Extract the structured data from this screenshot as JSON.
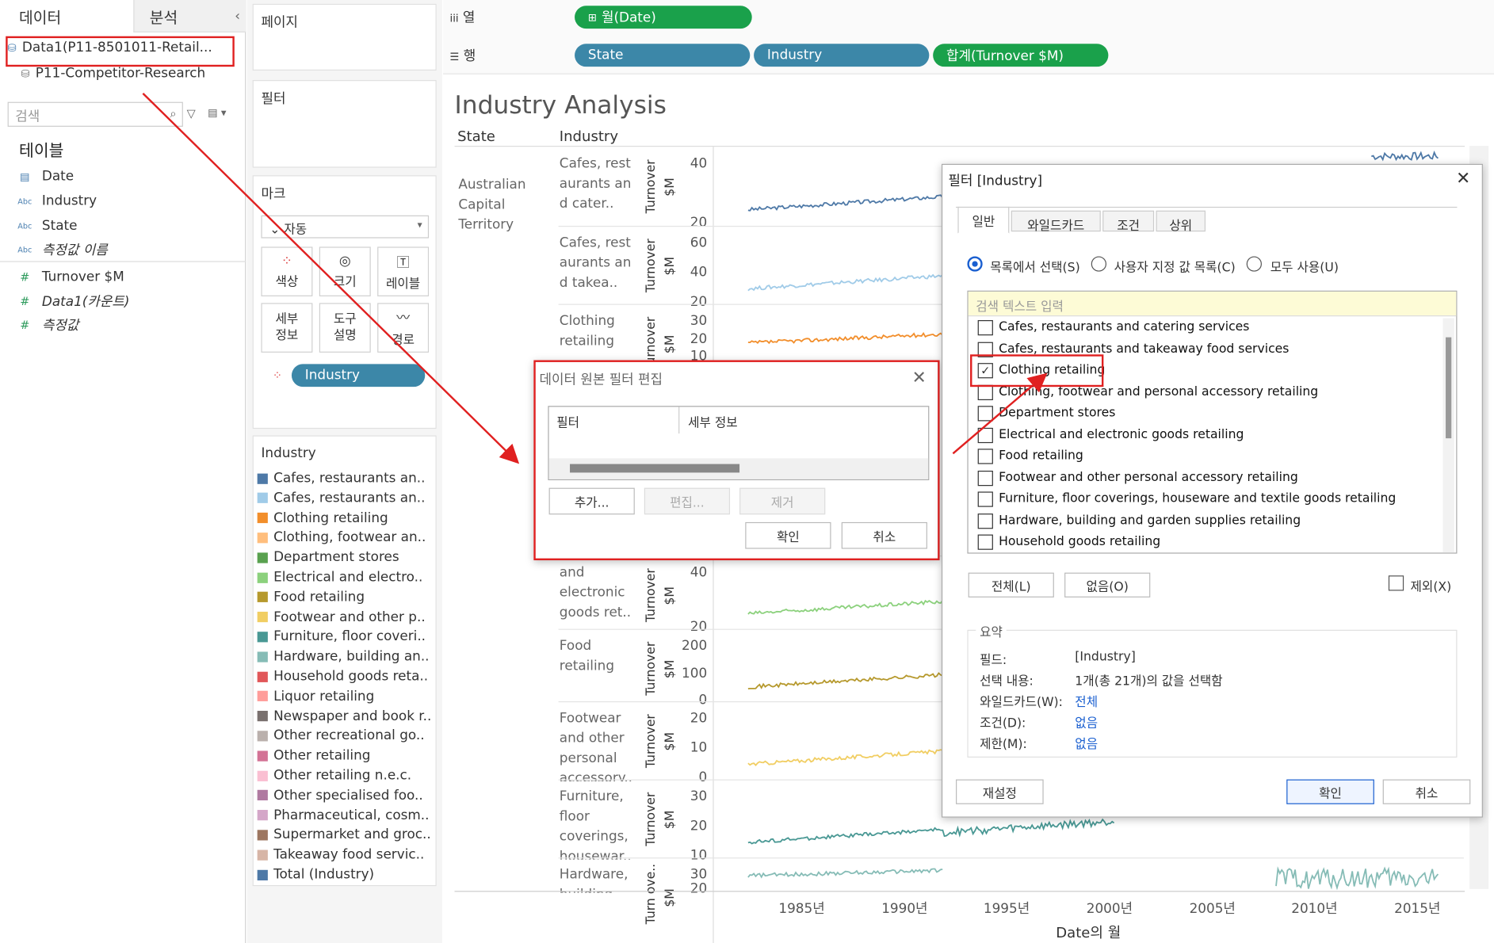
{
  "left": {
    "tab_data": "데이터",
    "tab_analysis": "분석",
    "collapse": "‹",
    "datasource_active": "Data1(P11-8501011-Retail...",
    "datasource_other": "P11-Competitor-Research",
    "search_placeholder": "검색",
    "tables_title": "테이블",
    "fields": [
      {
        "type": "date",
        "label": "Date"
      },
      {
        "type": "abc",
        "label": "Industry"
      },
      {
        "type": "abc",
        "label": "State"
      },
      {
        "type": "abc",
        "label": "측정값 이름"
      },
      {
        "type": "num",
        "label": "Turnover $M"
      },
      {
        "type": "num",
        "label": "Data1(카운트)"
      },
      {
        "type": "num",
        "label": "측정값"
      }
    ]
  },
  "shelves": {
    "pages": "페이지",
    "filters": "필터",
    "marks": "마크",
    "mark_type": "자동",
    "mark_buttons": [
      "색상",
      "크기",
      "레이블",
      "세부 정보",
      "도구 설명",
      "경로"
    ],
    "color_pill": "Industry",
    "columns_label": "열",
    "rows_label": "행",
    "columns_pill": "월(Date)",
    "rows_pills": [
      "State",
      "Industry",
      "합계(Turnover $M)"
    ]
  },
  "legend": {
    "title": "Industry",
    "items": [
      {
        "label": "Cafes, restaurants an..",
        "color": "#4e79a7"
      },
      {
        "label": "Cafes, restaurants an..",
        "color": "#a0cbe8"
      },
      {
        "label": "Clothing retailing",
        "color": "#f28e2b"
      },
      {
        "label": "Clothing, footwear an..",
        "color": "#ffbe7d"
      },
      {
        "label": "Department stores",
        "color": "#59a14f"
      },
      {
        "label": "Electrical and electro..",
        "color": "#8cd17d"
      },
      {
        "label": "Food retailing",
        "color": "#b6992d"
      },
      {
        "label": "Footwear and other p..",
        "color": "#f1ce63"
      },
      {
        "label": "Furniture, floor coveri..",
        "color": "#499894"
      },
      {
        "label": "Hardware, building an..",
        "color": "#86bcb6"
      },
      {
        "label": "Household goods reta..",
        "color": "#e15759"
      },
      {
        "label": "Liquor retailing",
        "color": "#ff9d9a"
      },
      {
        "label": "Newspaper and book r..",
        "color": "#79706e"
      },
      {
        "label": "Other recreational go..",
        "color": "#bab0ac"
      },
      {
        "label": "Other retailing",
        "color": "#d37295"
      },
      {
        "label": "Other retailing n.e.c.",
        "color": "#fabfd2"
      },
      {
        "label": "Other specialised foo..",
        "color": "#b07aa1"
      },
      {
        "label": "Pharmaceutical, cosm..",
        "color": "#d4a6c8"
      },
      {
        "label": "Supermarket and groc..",
        "color": "#9d7660"
      },
      {
        "label": "Takeaway food servic..",
        "color": "#d7b5a6"
      },
      {
        "label": "Total (Industry)",
        "color": "#4e79a7"
      }
    ]
  },
  "viz": {
    "title": "Industry Analysis",
    "col_state": "State",
    "col_industry": "Industry",
    "state_value": "Australian Capital Territory",
    "measure_label": "Turnover",
    "measure_unit": "$M",
    "rows": [
      {
        "industry": "Cafes, rest aurants an d cater..",
        "ticks": [
          "40",
          "20"
        ],
        "color": "#4e79a7"
      },
      {
        "industry": "Cafes, rest aurants an d takea..",
        "ticks": [
          "60",
          "40",
          "20"
        ],
        "color": "#a0cbe8"
      },
      {
        "industry": "Clothing retailing",
        "ticks": [
          "30",
          "20",
          "10"
        ],
        "color": "#f28e2b"
      },
      {
        "industry": "and electronic goods ret..",
        "ticks": [
          "40",
          "20"
        ],
        "color": "#8cd17d"
      },
      {
        "industry": "Food retailing",
        "ticks": [
          "200",
          "100",
          "0"
        ],
        "color": "#b6992d"
      },
      {
        "industry": "Footwear and other personal accessory..",
        "ticks": [
          "20",
          "10",
          "0"
        ],
        "color": "#f1ce63"
      },
      {
        "industry": "Furniture, floor coverings, housewar..",
        "ticks": [
          "30",
          "20",
          "10"
        ],
        "color": "#499894"
      },
      {
        "industry": "Hardware, building",
        "ticks": [
          "30",
          "20"
        ],
        "color": "#86bcb6"
      }
    ],
    "x_ticks": [
      "1985년",
      "1990년",
      "1995년",
      "2000년",
      "2005년",
      "2010년",
      "2015년"
    ],
    "x_label": "Date의 월",
    "last_row_measure": "Turn ove.."
  },
  "ds_filter_dialog": {
    "title": "데이터 원본 필터 편집",
    "col_filter": "필터",
    "col_details": "세부 정보",
    "add": "추가...",
    "edit": "편집...",
    "remove": "제거",
    "ok": "확인",
    "cancel": "취소"
  },
  "filter_dialog": {
    "title": "필터 [Industry]",
    "tabs": [
      "일반",
      "와일드카드",
      "조건",
      "상위"
    ],
    "radio_options": [
      "목록에서 선택(S)",
      "사용자 지정 값 목록(C)",
      "모두 사용(U)"
    ],
    "search_placeholder": "검색 텍스트 입력",
    "items": [
      {
        "label": "Cafes, restaurants and catering services",
        "checked": false
      },
      {
        "label": "Cafes, restaurants and takeaway food services",
        "checked": false
      },
      {
        "label": "Clothing retailing",
        "checked": true
      },
      {
        "label": "Clothing, footwear and personal accessory retailing",
        "checked": false
      },
      {
        "label": "Department stores",
        "checked": false
      },
      {
        "label": "Electrical and electronic goods retailing",
        "checked": false
      },
      {
        "label": "Food retailing",
        "checked": false
      },
      {
        "label": "Footwear and other personal accessory retailing",
        "checked": false
      },
      {
        "label": "Furniture, floor coverings, houseware and textile goods retailing",
        "checked": false
      },
      {
        "label": "Hardware, building and garden supplies retailing",
        "checked": false
      },
      {
        "label": "Household goods retailing",
        "checked": false
      }
    ],
    "all_btn": "전체(L)",
    "none_btn": "없음(O)",
    "exclude": "제외(X)",
    "summary_title": "요약",
    "summary": [
      {
        "k": "필드:",
        "v": "[Industry]",
        "link": false
      },
      {
        "k": "선택 내용:",
        "v": "1개(총 21개)의 값을 선택함",
        "link": false
      },
      {
        "k": "와일드카드(W):",
        "v": "전체",
        "link": true
      },
      {
        "k": "조건(D):",
        "v": "없음",
        "link": true
      },
      {
        "k": "제한(M):",
        "v": "없음",
        "link": true
      }
    ],
    "reset": "재설정",
    "ok": "확인",
    "cancel": "취소"
  }
}
